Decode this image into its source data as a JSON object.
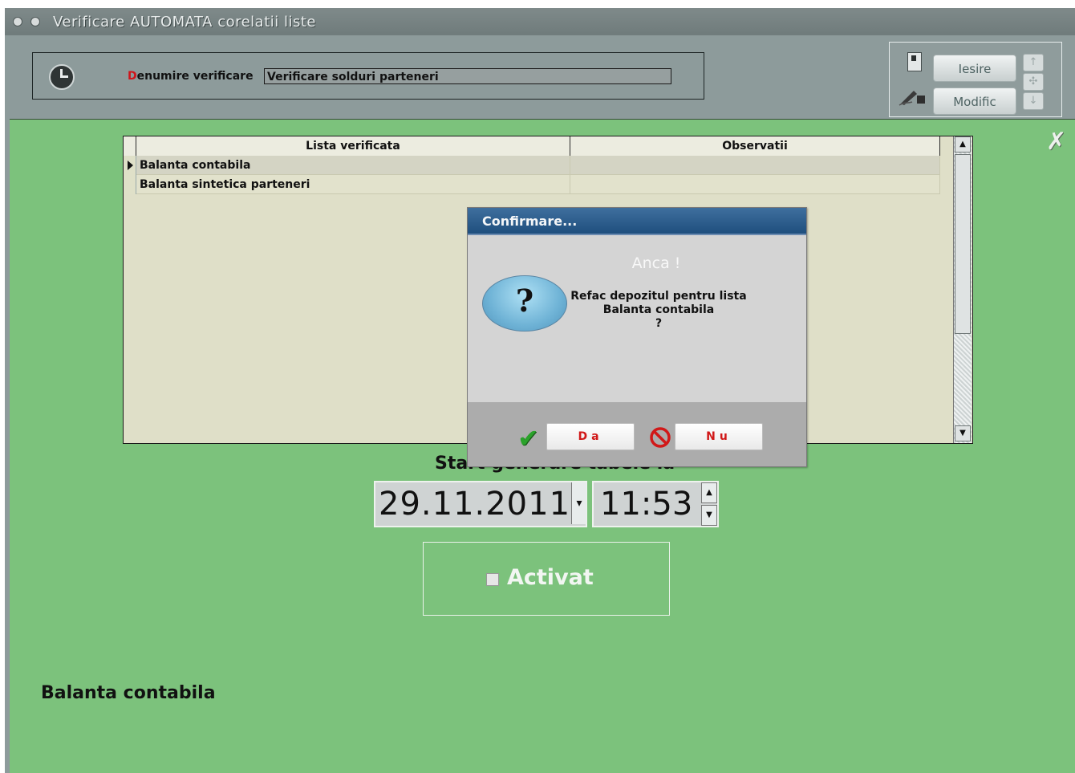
{
  "window": {
    "title": "Verificare AUTOMATA corelatii liste"
  },
  "header": {
    "denumire_label_first": "D",
    "denumire_label_rest": "enumire verificare",
    "denumire_value": "Verificare solduri parteneri",
    "icon": "clock-icon"
  },
  "toolbar": {
    "iesire_label": "Iesire",
    "modific_label": "Modific",
    "nav_up": "↑",
    "nav_mid": "✣",
    "nav_down": "↓"
  },
  "grid": {
    "columns": [
      "Lista verificata",
      "Observatii"
    ],
    "rows": [
      {
        "lista": "Balanta contabila",
        "obs": "",
        "selected": true
      },
      {
        "lista": "Balanta sintetica parteneri",
        "obs": "",
        "selected": false
      }
    ]
  },
  "schedule": {
    "label": "Start generare tabele la",
    "date": "29.11.2011",
    "time": "11:53"
  },
  "activ": {
    "label": "Activat",
    "checked": false
  },
  "status": {
    "current_list": "Balanta contabila"
  },
  "dialog": {
    "title": "Confirmare...",
    "greeting": "Anca !",
    "message_line1": "Refac depozitul pentru lista",
    "message_line2": "Balanta contabila",
    "message_line3": "?",
    "question_mark": "?",
    "yes_label": "Da",
    "no_label": "Nu"
  },
  "colors": {
    "main_bg": "#7cc27c",
    "frame_bg": "#8d9b9b",
    "dialog_title": "#2a5a8a",
    "accent_red": "#d11818"
  }
}
